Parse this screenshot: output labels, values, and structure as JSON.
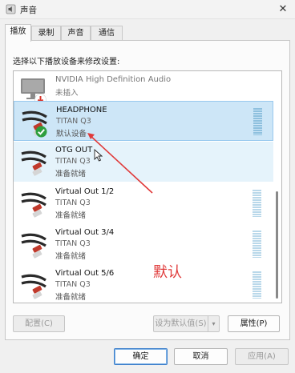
{
  "window": {
    "title": "声音",
    "close_glyph": "✕"
  },
  "tabs": [
    {
      "label": "播放",
      "active": true
    },
    {
      "label": "录制",
      "active": false
    },
    {
      "label": "声音",
      "active": false
    },
    {
      "label": "通信",
      "active": false
    }
  ],
  "instruction": "选择以下播放设备来修改设置:",
  "devices": [
    {
      "name": "NVIDIA High Definition Audio",
      "sub": "",
      "status": "未插入",
      "icon": "monitor-icon",
      "badge": "unplugged-arrow-icon",
      "selected": false
    },
    {
      "name": "HEADPHONE",
      "sub": "TITAN Q3",
      "status": "默认设备",
      "icon": "rca-cable-icon",
      "badge": "default-check-icon",
      "selected": true
    },
    {
      "name": "OTG OUT",
      "sub": "TITAN Q3",
      "status": "准备就绪",
      "icon": "rca-cable-icon",
      "badge": "",
      "selected": false
    },
    {
      "name": "Virtual Out 1/2",
      "sub": "TITAN Q3",
      "status": "准备就绪",
      "icon": "rca-cable-icon",
      "badge": "",
      "selected": false
    },
    {
      "name": "Virtual Out 3/4",
      "sub": "TITAN Q3",
      "status": "准备就绪",
      "icon": "rca-cable-icon",
      "badge": "",
      "selected": false
    },
    {
      "name": "Virtual Out 5/6",
      "sub": "TITAN Q3",
      "status": "准备就绪",
      "icon": "rca-cable-icon",
      "badge": "",
      "selected": false
    }
  ],
  "annotation": {
    "text": "默认",
    "color": "#e03a3a"
  },
  "buttons": {
    "configure": "配置(C)",
    "set_default": "设为默认值(S)",
    "set_default_arrow": "▾",
    "properties": "属性(P)",
    "ok": "确定",
    "cancel": "取消",
    "apply": "应用(A)"
  },
  "colors": {
    "selection": "#cde6f7",
    "accent": "#3d7fcb"
  }
}
